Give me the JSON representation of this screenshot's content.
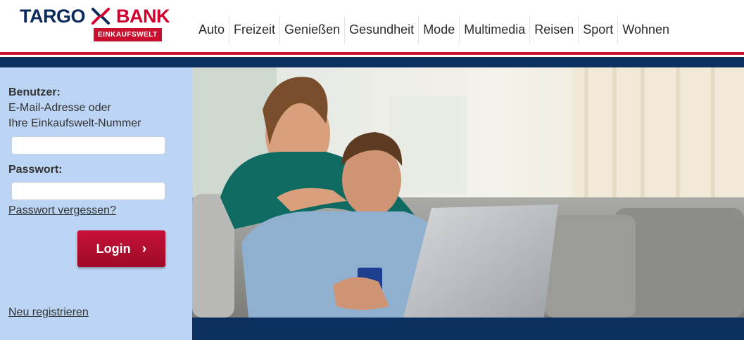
{
  "logo": {
    "word1": "TARGO",
    "word2": "BANK",
    "subtitle": "EINKAUFSWELT",
    "colors": {
      "navy": "#0b2a5c",
      "red": "#d2002c"
    }
  },
  "nav": {
    "items": [
      "Auto",
      "Freizeit",
      "Genießen",
      "Gesundheit",
      "Mode",
      "Multimedia",
      "Reisen",
      "Sport",
      "Wohnen"
    ]
  },
  "login": {
    "user_label": "Benutzer:",
    "user_hint_line1": "E-Mail-Adresse oder",
    "user_hint_line2": "Ihre Einkaufswelt-Nummer",
    "user_value": "",
    "password_label": "Passwort:",
    "password_value": "",
    "forgot_link": "Passwort vergessen?",
    "login_button": "Login",
    "login_arrow_icon": "chevron-right-icon",
    "register_link": "Neu registrieren"
  },
  "theme": {
    "panel_bg": "#bdd5f4",
    "navy": "#0b2f5e",
    "red": "#c8102e"
  }
}
